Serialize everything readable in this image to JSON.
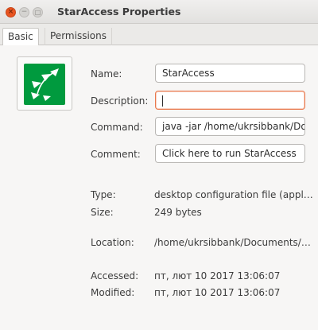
{
  "window": {
    "title": "StarAccess Properties",
    "colors": {
      "close_button": "#e95420",
      "focus_border": "#e9794d",
      "app_icon_bg": "#009a3e"
    }
  },
  "tabs": [
    {
      "label": "Basic",
      "active": true
    },
    {
      "label": "Permissions",
      "active": false
    }
  ],
  "icons": {
    "close": "close-icon",
    "minimize": "minimize-icon",
    "maximize": "maximize-icon",
    "app": "staraccess-app-icon"
  },
  "fields": {
    "name": {
      "label": "Name:",
      "value": "StarAccess"
    },
    "description": {
      "label": "Description:",
      "value": ""
    },
    "command": {
      "label": "Command:",
      "value": "java -jar /home/ukrsibbank/Do"
    },
    "comment": {
      "label": "Comment:",
      "value": "Click here to run StarAccess"
    }
  },
  "info": {
    "type": {
      "label": "Type:",
      "value": "desktop configuration file (appl…"
    },
    "size": {
      "label": "Size:",
      "value": "249 bytes"
    },
    "location": {
      "label": "Location:",
      "value": "/home/ukrsibbank/Documents/…"
    },
    "accessed": {
      "label": "Accessed:",
      "value": "пт, лют 10 2017 13:06:07"
    },
    "modified": {
      "label": "Modified:",
      "value": "пт, лют 10 2017 13:06:07"
    }
  }
}
